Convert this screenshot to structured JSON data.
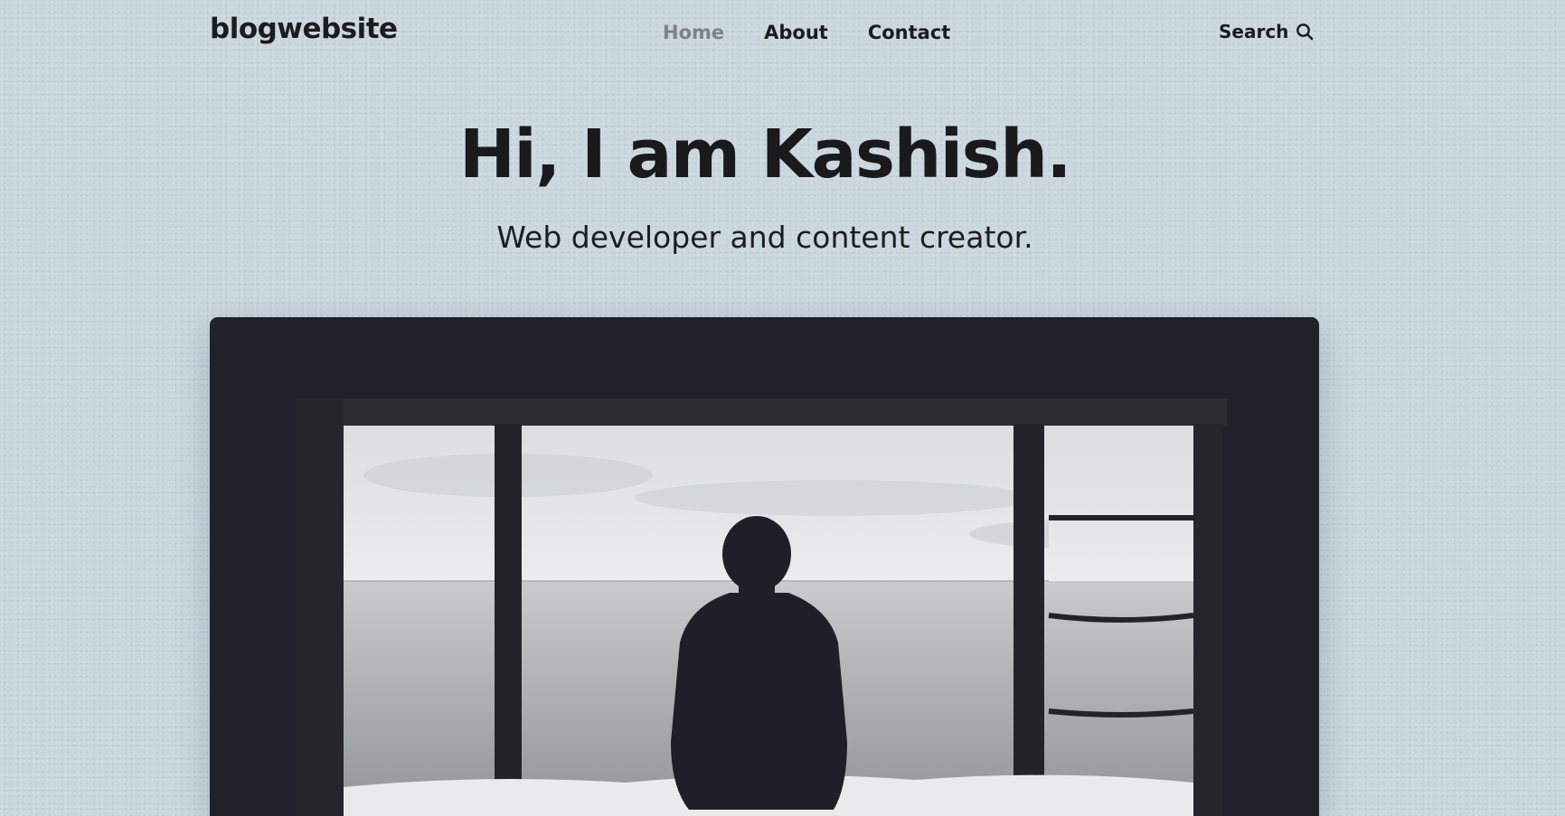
{
  "header": {
    "logo": "blogwebsite",
    "nav": [
      {
        "label": "Home",
        "active": true
      },
      {
        "label": "About",
        "active": false
      },
      {
        "label": "Contact",
        "active": false
      }
    ],
    "search_label": "Search",
    "search_icon": "search-icon"
  },
  "hero": {
    "title": "Hi, I am Kashish.",
    "subtitle": "Web developer and content creator."
  },
  "featured_image": {
    "subject": "silhouette of person looking at sea through window"
  },
  "colors": {
    "background": "#cad7df",
    "text": "#1c1c1e",
    "nav_active": "#808288",
    "image_frame": "#22232a"
  }
}
